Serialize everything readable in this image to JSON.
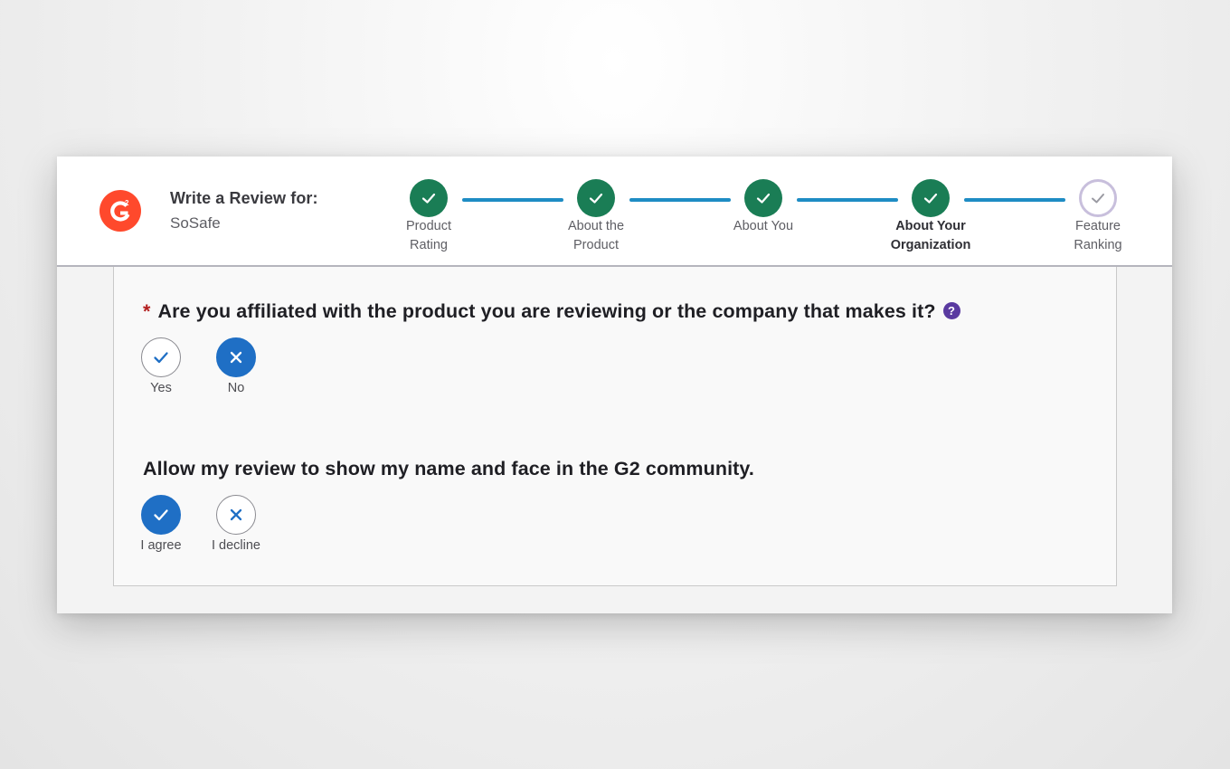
{
  "header": {
    "title": "Write a Review for:",
    "product": "SoSafe",
    "logo_text": "G2"
  },
  "steps": [
    {
      "line1": "Product",
      "line2": "Rating",
      "status": "complete"
    },
    {
      "line1": "About the",
      "line2": "Product",
      "status": "complete"
    },
    {
      "line1": "About You",
      "line2": "",
      "status": "complete"
    },
    {
      "line1": "About Your",
      "line2": "Organization",
      "status": "active"
    },
    {
      "line1": "Feature",
      "line2": "Ranking",
      "status": "pending"
    }
  ],
  "questions": {
    "affiliation": {
      "required_marker": "*",
      "text": "Are you affiliated with the product you are reviewing or the company that makes it?",
      "help_icon": "?",
      "options": [
        {
          "label": "Yes",
          "selected": false,
          "icon": "check-icon"
        },
        {
          "label": "No",
          "selected": true,
          "icon": "x-icon"
        }
      ]
    },
    "identity": {
      "text": "Allow my review to show my name and face in the G2 community.",
      "options": [
        {
          "label": "I agree",
          "selected": true,
          "icon": "check-icon"
        },
        {
          "label": "I decline",
          "selected": false,
          "icon": "x-icon"
        }
      ]
    }
  },
  "colors": {
    "brand": "#ff492c",
    "step_complete": "#1a7d55",
    "step_connector": "#1e8cc4",
    "option_selected": "#1f6fc5",
    "help": "#5a3aa0"
  }
}
